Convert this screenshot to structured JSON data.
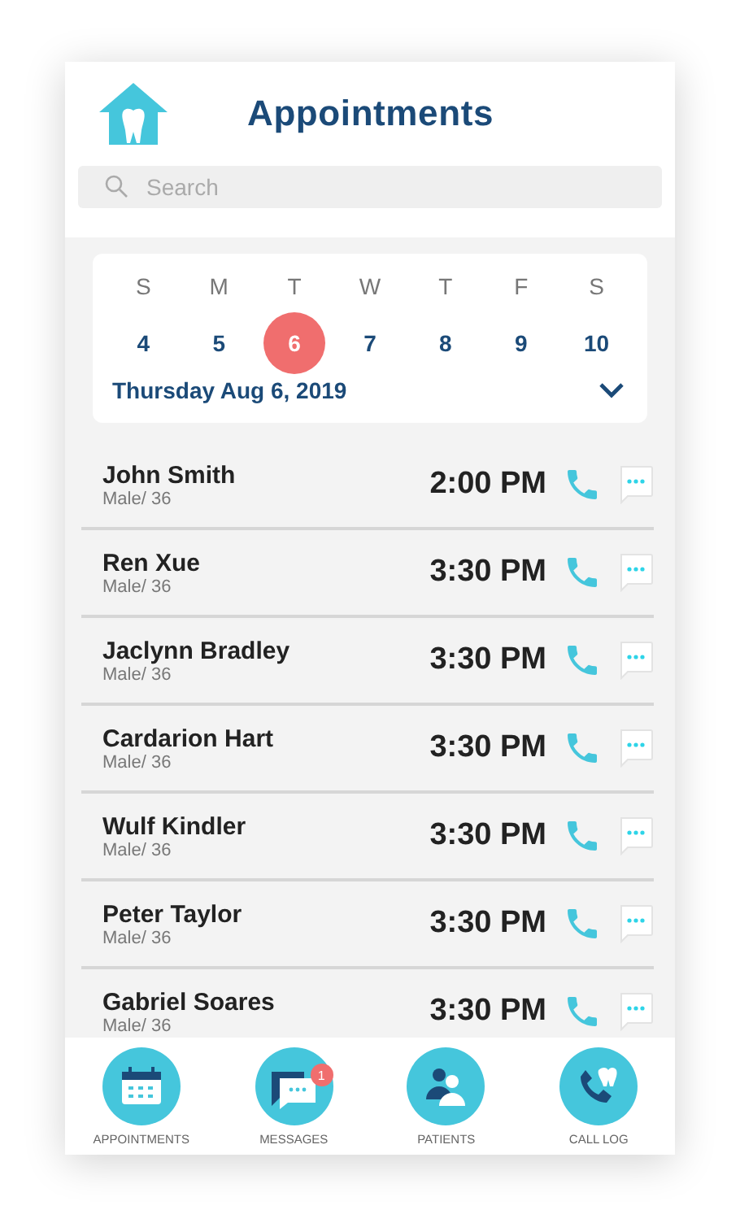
{
  "header": {
    "title": "Appointments"
  },
  "search": {
    "placeholder": "Search"
  },
  "calendar": {
    "weekdays": [
      "S",
      "M",
      "T",
      "W",
      "T",
      "F",
      "S"
    ],
    "days": [
      {
        "label": "4",
        "selected": false
      },
      {
        "label": "5",
        "selected": false
      },
      {
        "label": "6",
        "selected": true
      },
      {
        "label": "7",
        "selected": false
      },
      {
        "label": "8",
        "selected": false
      },
      {
        "label": "9",
        "selected": false
      },
      {
        "label": "10",
        "selected": false
      }
    ],
    "date_label": "Thursday Aug 6, 2019"
  },
  "appointments": [
    {
      "name": "John Smith",
      "details": "Male/ 36",
      "time": "2:00 PM"
    },
    {
      "name": "Ren Xue",
      "details": "Male/ 36",
      "time": "3:30 PM"
    },
    {
      "name": "Jaclynn Bradley",
      "details": "Male/ 36",
      "time": "3:30 PM"
    },
    {
      "name": "Cardarion Hart",
      "details": "Male/ 36",
      "time": "3:30 PM"
    },
    {
      "name": "Wulf Kindler",
      "details": "Male/ 36",
      "time": "3:30 PM"
    },
    {
      "name": "Peter Taylor",
      "details": "Male/ 36",
      "time": "3:30 PM"
    },
    {
      "name": "Gabriel Soares",
      "details": "Male/ 36",
      "time": "3:30 PM"
    }
  ],
  "nav": [
    {
      "kind": "calendar",
      "label": "APPOINTMENTS"
    },
    {
      "kind": "messages",
      "label": "MESSAGES",
      "badge": "1"
    },
    {
      "kind": "patients",
      "label": "PATIENTS"
    },
    {
      "kind": "calllog",
      "label": "CALL LOG"
    }
  ]
}
